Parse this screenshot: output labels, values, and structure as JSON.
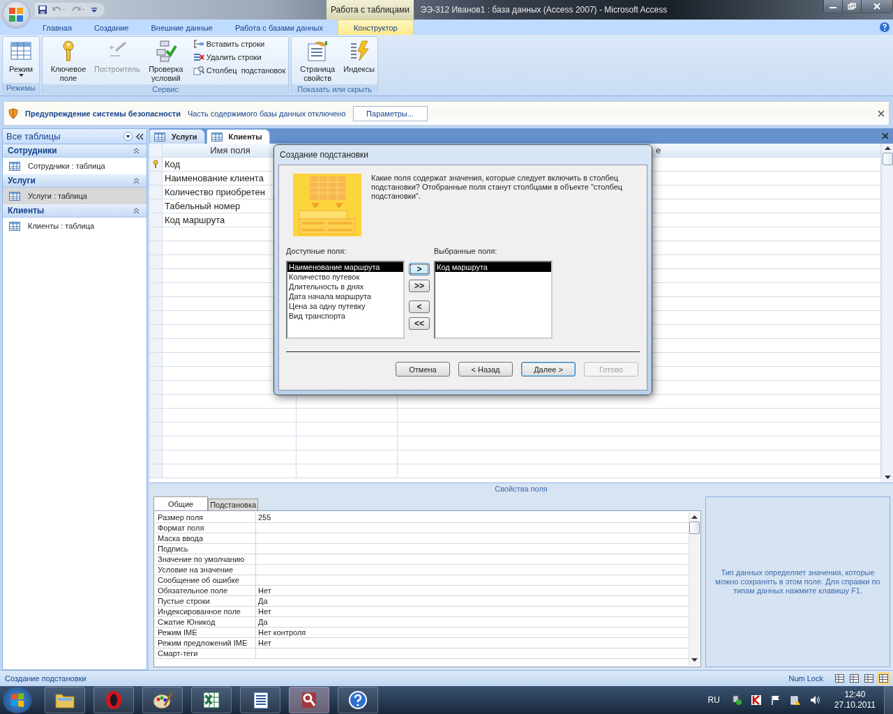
{
  "window": {
    "title": "ЭЭ-312 Иванов1 : база данных (Access 2007)  -  Microsoft Access",
    "contextual_tab": "Работа с таблицами"
  },
  "ribbon": {
    "tabs": [
      {
        "label": "Главная",
        "selected": false
      },
      {
        "label": "Создание",
        "selected": false
      },
      {
        "label": "Внешние данные",
        "selected": false
      },
      {
        "label": "Работа с базами данных",
        "selected": false
      },
      {
        "label": "Конструктор",
        "selected": true
      }
    ],
    "groups": [
      {
        "label": "Режимы",
        "buttons": [
          {
            "kind": "large",
            "label": "Режим",
            "disabled": false
          }
        ]
      },
      {
        "label": "Сервис",
        "buttons": [
          {
            "kind": "large",
            "label": "Ключевое поле",
            "disabled": false
          },
          {
            "kind": "large",
            "label": "Построитель",
            "disabled": true
          },
          {
            "kind": "large",
            "label": "Проверка условий",
            "disabled": false
          },
          {
            "kind": "small",
            "label": "Вставить строки",
            "disabled": false
          },
          {
            "kind": "small",
            "label": "Удалить строки",
            "disabled": false
          },
          {
            "kind": "small",
            "label": "Столбец  подстановок",
            "disabled": false
          }
        ]
      },
      {
        "label": "Показать или скрыть",
        "buttons": [
          {
            "kind": "large",
            "label": "Страница свойств",
            "disabled": false
          },
          {
            "kind": "large",
            "label": "Индексы",
            "disabled": false
          }
        ]
      }
    ]
  },
  "security_bar": {
    "title": "Предупреждение системы безопасности",
    "message": "Часть содержимого базы данных отключено",
    "button": "Параметры..."
  },
  "nav_pane": {
    "title": "Все таблицы",
    "groups": [
      {
        "label": "Сотрудники",
        "items": [
          {
            "label": "Сотрудники : таблица",
            "selected": false
          }
        ]
      },
      {
        "label": "Услуги",
        "items": [
          {
            "label": "Услуги : таблица",
            "selected": true
          }
        ]
      },
      {
        "label": "Клиенты",
        "items": [
          {
            "label": "Клиенты : таблица",
            "selected": false
          }
        ]
      }
    ]
  },
  "doc_tabs": [
    {
      "label": "Услуги",
      "selected": false
    },
    {
      "label": "Клиенты",
      "selected": true
    }
  ],
  "field_grid": {
    "column_1": "Имя поля",
    "column_3": "е",
    "rows": [
      {
        "name": "Код",
        "primary_key": true
      },
      {
        "name": "Наименование клиента",
        "primary_key": false
      },
      {
        "name": "Количество приобретен",
        "primary_key": false
      },
      {
        "name": "Табельный номер",
        "primary_key": false
      },
      {
        "name": "Код маршрута",
        "primary_key": false
      }
    ]
  },
  "field_properties": {
    "title": "Свойства поля",
    "tabs": [
      {
        "label": "Общие",
        "selected": true
      },
      {
        "label": "Подстановка",
        "selected": false
      }
    ],
    "rows": [
      {
        "name": "Размер поля",
        "value": "255"
      },
      {
        "name": "Формат поля"
      },
      {
        "name": "Маска ввода"
      },
      {
        "name": "Подпись"
      },
      {
        "name": "Значение по умолчанию"
      },
      {
        "name": "Условие на значение"
      },
      {
        "name": "Сообщение об ошибке"
      },
      {
        "name": "Обязательное поле",
        "value": "Нет"
      },
      {
        "name": "Пустые строки",
        "value": "Да"
      },
      {
        "name": "Индексированное поле",
        "value": "Нет"
      },
      {
        "name": "Сжатие Юникод",
        "value": "Да"
      },
      {
        "name": "Режим IME",
        "value": "Нет контроля"
      },
      {
        "name": "Режим предложений IME",
        "value": "Нет"
      },
      {
        "name": "Смарт-теги"
      }
    ],
    "help": "Тип данных определяет значения, которые можно сохранять в этом поле.  Для справки по типам данных нажмите клавишу F1."
  },
  "dialog": {
    "title": "Создание подстановки",
    "prompt": "Какие поля содержат значения, которые следует включить в столбец подстановки? Отобранные поля станут столбцами в объекте \"столбец подстановки\".",
    "available_label": "Доступные поля:",
    "available": [
      {
        "label": "Наименование маршрута",
        "selected": true
      },
      {
        "label": "Количество путевок",
        "selected": false
      },
      {
        "label": "Длительность в днях",
        "selected": false
      },
      {
        "label": "Дата начала маршрута",
        "selected": false
      },
      {
        "label": "Цена за одну путевку",
        "selected": false
      },
      {
        "label": "Вид транспорта",
        "selected": false
      }
    ],
    "chosen_label": "Выбранные поля:",
    "chosen": [
      {
        "label": "Код маршрута",
        "selected": true
      }
    ],
    "move_buttons": [
      {
        "label": ">",
        "focused": true
      },
      {
        "label": ">>",
        "focused": false
      },
      {
        "label": "<",
        "focused": false
      },
      {
        "label": "<<",
        "focused": false
      }
    ],
    "buttons": [
      {
        "label": "Отмена",
        "disabled": false,
        "default": false
      },
      {
        "label": "< Назад",
        "disabled": false,
        "default": false
      },
      {
        "label": "Далее >",
        "disabled": false,
        "default": true
      },
      {
        "label": "Готово",
        "disabled": true,
        "default": false
      }
    ]
  },
  "status_bar": {
    "text": "Создание подстановки",
    "indicator": "Num Lock"
  },
  "taskbar": {
    "language": "RU",
    "time": "12:40",
    "date": "27.10.2011"
  }
}
